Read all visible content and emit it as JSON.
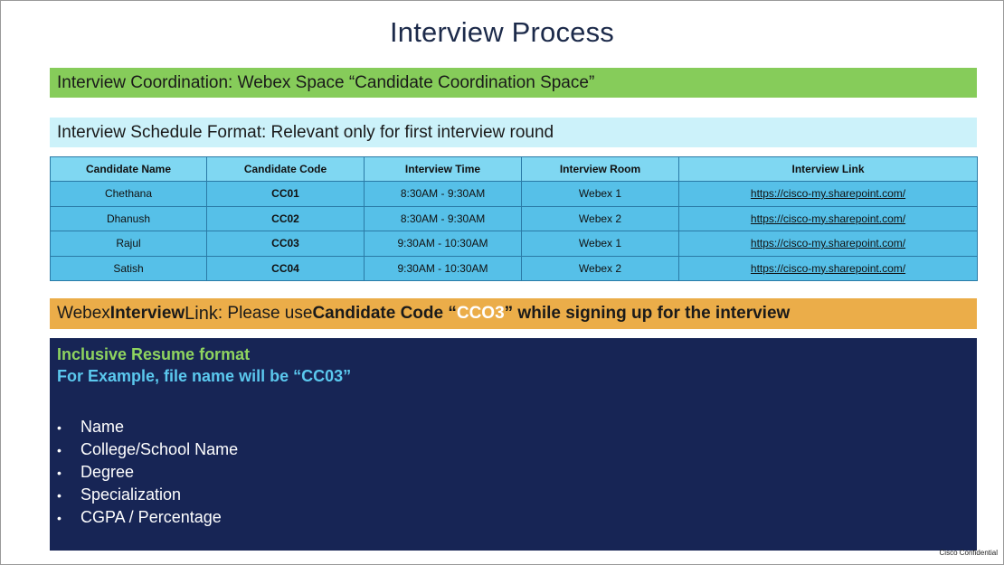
{
  "title": "Interview Process",
  "coordination": "Interview Coordination:  Webex Space “Candidate Coordination Space”",
  "schedule_format": "Interview Schedule Format: Relevant only for first interview round",
  "table": {
    "headers": [
      "Candidate Name",
      "Candidate Code",
      "Interview Time",
      "Interview Room",
      "Interview Link"
    ],
    "rows": [
      [
        "Chethana",
        "CC01",
        "8:30AM - 9:30AM",
        "Webex 1",
        "https://cisco-my.sharepoint.com/"
      ],
      [
        "Dhanush",
        "CC02",
        "8:30AM - 9:30AM",
        "Webex 2",
        "https://cisco-my.sharepoint.com/"
      ],
      [
        "Rajul",
        "CC03",
        "9:30AM - 10:30AM",
        "Webex 1",
        "https://cisco-my.sharepoint.com/"
      ],
      [
        "Satish",
        "CC04",
        "9:30AM - 10:30AM",
        "Webex 2",
        "https://cisco-my.sharepoint.com/"
      ]
    ]
  },
  "webex_link": {
    "part1": "Webex ",
    "part2": "Interview",
    "part3": " Link",
    "part4": " : Please use ",
    "part5": "Candidate Code “",
    "code": "CCO3",
    "part6": "” while signing up for the interview"
  },
  "resume": {
    "heading": "Inclusive Resume format",
    "example": "For Example, file name will be “CC03”",
    "items": [
      "Name",
      "College/School Name",
      "Degree",
      "Specialization",
      "CGPA / Percentage"
    ]
  },
  "footer": "Cisco Confidential",
  "colors": {
    "title": "#1c2a4a",
    "green_banner": "#86cc5a",
    "cyan_banner": "#ccf2fa",
    "table_header": "#7fd7f2",
    "table_cell": "#56c0e8",
    "orange_banner": "#ebad49",
    "navy_panel": "#172555"
  }
}
